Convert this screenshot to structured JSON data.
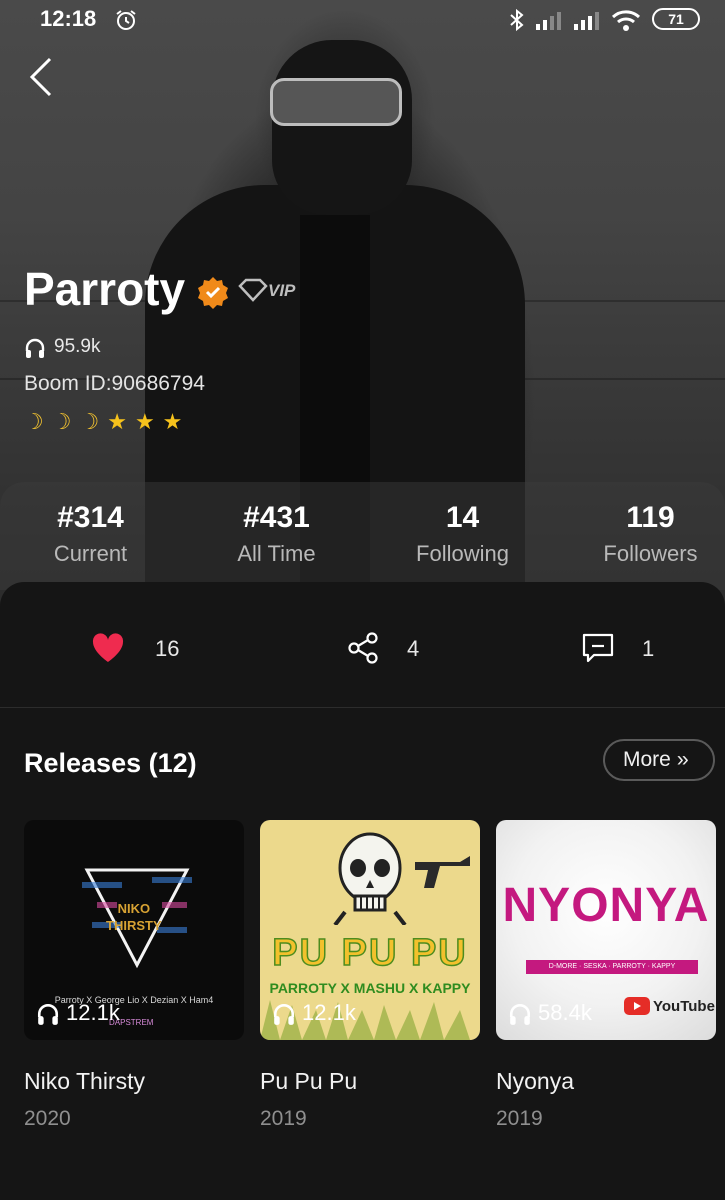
{
  "status_bar": {
    "time": "12:18",
    "battery": "71"
  },
  "artist": {
    "name": "Parroty",
    "vip_label": "VIP",
    "plays": "95.9k",
    "boom_id": "Boom ID:90686794",
    "rating": {
      "moons": 3,
      "stars": 3
    }
  },
  "stats": [
    {
      "value": "#314",
      "label": "Current"
    },
    {
      "value": "#431",
      "label": "All Time"
    },
    {
      "value": "14",
      "label": "Following"
    },
    {
      "value": "119",
      "label": "Followers"
    }
  ],
  "actions": {
    "likes": "16",
    "shares": "4",
    "comments": "1"
  },
  "releases": {
    "title": "Releases (12)",
    "more_label": "More",
    "items": [
      {
        "title": "Niko Thirsty",
        "year": "2020",
        "plays": "12.1k",
        "cover_text": [
          "NIKO",
          "THIRSTY"
        ],
        "cover_credit": "Parroty X George Lio X Dezian X Ham4",
        "cover_stamp": "DAPSTREM"
      },
      {
        "title": "Pu Pu Pu",
        "year": "2019",
        "plays": "12.1k",
        "cover_text": "PU PU PU",
        "cover_credit": "PARROTY X MASHU X KAPPY"
      },
      {
        "title": "Nyonya",
        "year": "2019",
        "plays": "58.4k",
        "cover_text": "NYONYA",
        "cover_credit": "D-MORE · SESKA · PARROTY · KAPPY",
        "cover_badge": "YouTube"
      }
    ]
  },
  "colors": {
    "heart": "#ef2b4f",
    "verified": "#f08a1a",
    "star": "#f6c21c"
  }
}
